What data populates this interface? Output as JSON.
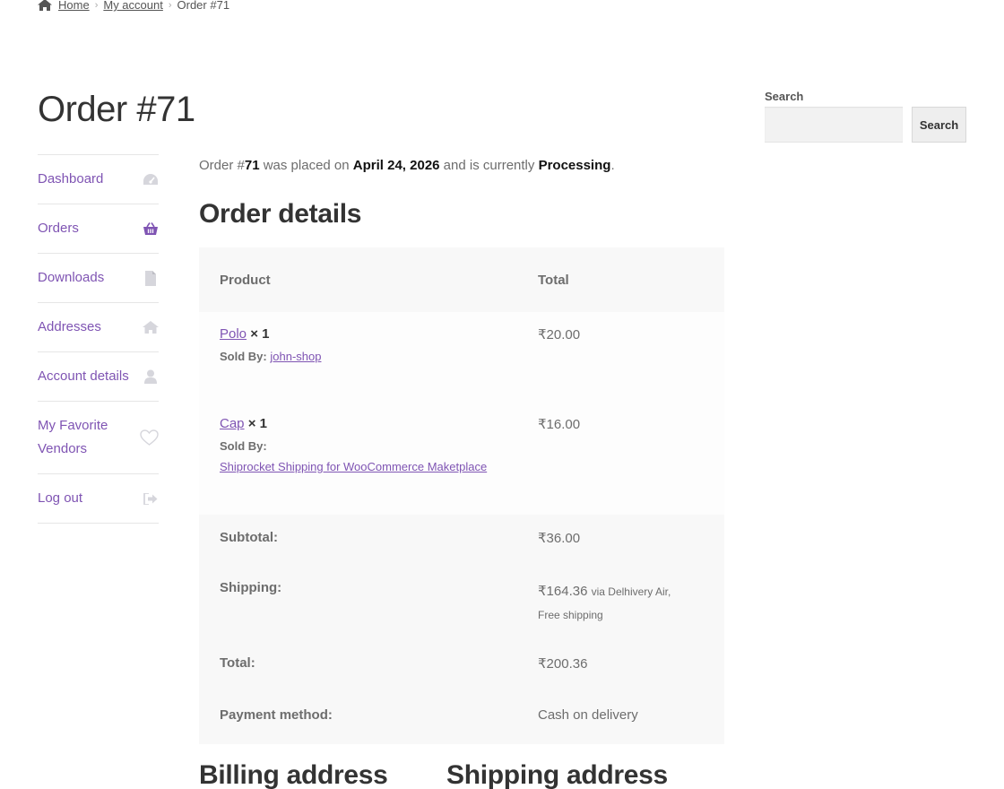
{
  "breadcrumb": {
    "home_icon": "home-icon",
    "items": [
      "Home",
      "My account"
    ],
    "current": "Order #71"
  },
  "page_title": "Order #71",
  "account_nav": [
    {
      "label": "Dashboard",
      "icon": "dashboard-gauge-icon"
    },
    {
      "label": "Orders",
      "icon": "basket-icon"
    },
    {
      "label": "Downloads",
      "icon": "file-icon"
    },
    {
      "label": "Addresses",
      "icon": "home-icon"
    },
    {
      "label": "Account details",
      "icon": "user-icon"
    },
    {
      "label": "My Favorite Vendors",
      "icon": "heart-icon"
    },
    {
      "label": "Log out",
      "icon": "sign-out-icon"
    }
  ],
  "order_summary": {
    "prefix": "Order #",
    "number": "71",
    "placed_text": " was placed on ",
    "date": "April 24, 2026",
    "status_text": " and is currently ",
    "status": "Processing",
    "suffix": "."
  },
  "order_details": {
    "title": "Order details",
    "headers": {
      "product": "Product",
      "total": "Total"
    },
    "items": [
      {
        "product": "Polo",
        "qty": "× 1",
        "sold_by_label": "Sold By:",
        "vendor": "john-shop",
        "total": "₹20.00"
      },
      {
        "product": "Cap",
        "qty": "× 1",
        "sold_by_label": "Sold By:",
        "vendor": "Shiprocket Shipping for WooCommerce Maketplace",
        "total": "₹16.00"
      }
    ],
    "totals": {
      "subtotal_label": "Subtotal:",
      "subtotal": "₹36.00",
      "shipping_label": "Shipping:",
      "shipping": "₹164.36",
      "shipping_meta": "via Delhivery Air, Free shipping",
      "total_label": "Total:",
      "total": "₹200.36",
      "payment_label": "Payment method:",
      "payment": "Cash on delivery"
    }
  },
  "billing_title": "Billing address",
  "shipping_title": "Shipping address",
  "search": {
    "label": "Search",
    "placeholder": "",
    "button": "Search"
  },
  "colors": {
    "link": "#7f54b3",
    "heading": "#333333",
    "text": "#6d6d6d",
    "table_bg": "#f8f8f8"
  }
}
